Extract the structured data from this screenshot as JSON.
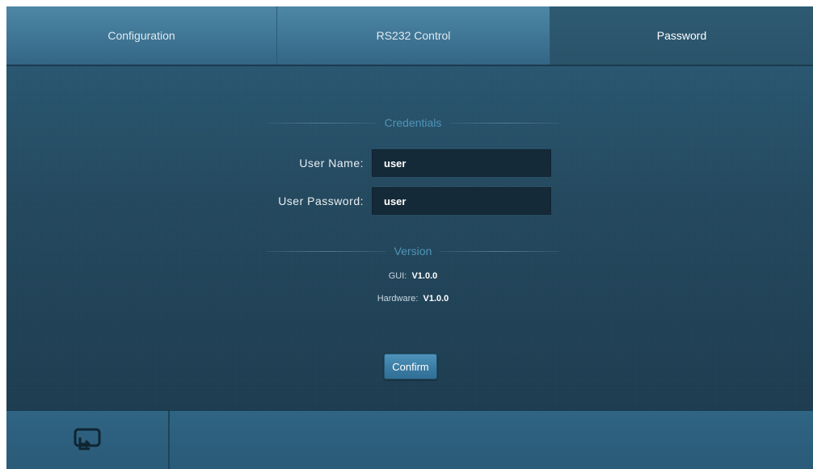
{
  "tabs": [
    {
      "label": "Configuration",
      "active": false
    },
    {
      "label": "RS232 Control",
      "active": false
    },
    {
      "label": "Password",
      "active": true
    }
  ],
  "credentials": {
    "title": "Credentials",
    "username_label": "User Name:",
    "username_value": "user",
    "password_label": "User Password:",
    "password_value": "user"
  },
  "version": {
    "title": "Version",
    "gui_label": "GUI:",
    "gui_value": "V1.0.0",
    "hardware_label": "Hardware:",
    "hardware_value": "V1.0.0"
  },
  "actions": {
    "confirm_label": "Confirm"
  },
  "footer": {
    "back_icon": "back-return-icon"
  },
  "colors": {
    "accent": "#4e95b8",
    "panel": "#24495f",
    "tab_bar": "#3f7594",
    "active_tab": "#2c5770"
  }
}
